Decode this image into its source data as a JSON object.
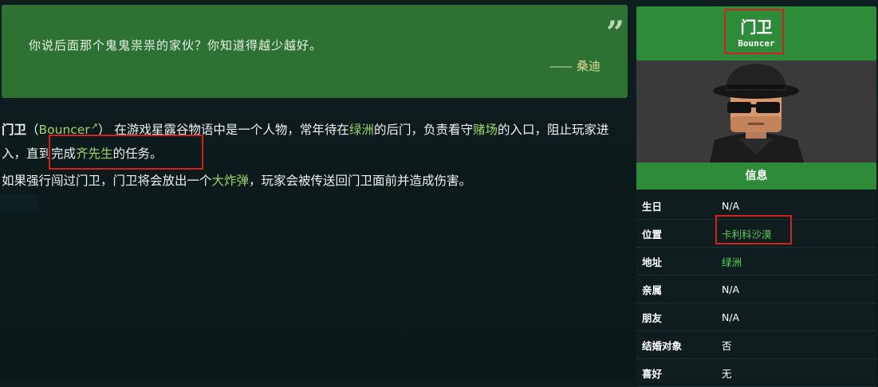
{
  "quote": {
    "text": "你说后面那个鬼鬼祟祟的家伙？你知道得越少越好。",
    "dash": "——",
    "author": "桑迪",
    "mark": "”"
  },
  "article": {
    "p1": {
      "name": "门卫",
      "open": "（",
      "en_name": "Bouncer",
      "ext_icon": "↗",
      "close": "）",
      "t1": "在游戏星露谷物语中是一个人物，常年待在",
      "link1": "绿洲",
      "t2": "的后门，负责看守",
      "link2": "赌场",
      "t3": "的入口，阻止玩家进入，直到完成",
      "link3": "齐先生",
      "t4": "的任务。"
    },
    "p2": {
      "t1": "如果强行闯过门卫，门卫将会放出一个",
      "link1": "大炸弹",
      "t2": "，玩家会被传送回门卫面前并造成伤害。"
    }
  },
  "infobox": {
    "title": "门卫",
    "subtitle": "Bouncer",
    "section": "信息",
    "rows": [
      {
        "k": "生日",
        "v": "N/A",
        "link": false
      },
      {
        "k": "位置",
        "v": "卡利科沙漠",
        "link": true
      },
      {
        "k": "地址",
        "v": "绿洲",
        "link": true
      },
      {
        "k": "亲属",
        "v": "N/A",
        "link": false
      },
      {
        "k": "朋友",
        "v": "N/A",
        "link": false
      },
      {
        "k": "结婚对象",
        "v": "否",
        "link": false
      },
      {
        "k": "喜好",
        "v": "无",
        "link": false
      }
    ]
  },
  "colors": {
    "quote_bg": "#2e7233",
    "header_bg": "#2e8b3a",
    "link_green": "#9ed36a",
    "highlight": "#d42020"
  }
}
